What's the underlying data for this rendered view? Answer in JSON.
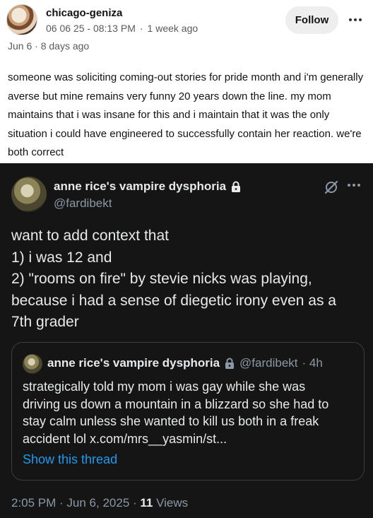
{
  "post": {
    "blog_name": "chicago-geniza",
    "reblog_timestamp": "06 06 25 - 08:13 PM",
    "relative_time": "1 week ago",
    "follow_label": "Follow",
    "post_date": "Jun 6 · 8 days ago",
    "body": "someone was soliciting coming-out stories for pride month and i'm generally averse but mine remains very funny 20 years down the line. my mom maintains that i was insane for this and i maintain that it was the only situation i could have engineered to successfully contain her reaction. we're both correct"
  },
  "tweet": {
    "display_name": "anne rice's vampire dysphoria",
    "handle": "@fardibekt",
    "text_lines": [
      "want to add context that",
      "1) i was 12 and",
      "2) \"rooms on fire\" by stevie nicks was playing,",
      "because i had a sense of diegetic irony even as a",
      "7th grader"
    ],
    "quote": {
      "display_name": "anne rice's vampire dysphoria",
      "handle": "@fardibekt",
      "time": "· 4h",
      "text_lines": [
        "strategically told my mom i was gay while she was",
        "driving us down a mountain in a blizzard so she had to",
        "stay calm unless she wanted to kill us both in a freak",
        "accident lol x.com/mrs__yasmin/st..."
      ],
      "show_thread": "Show this thread"
    },
    "footer_time": "2:05 PM · Jun 6, 2025 ·",
    "views_count": "11",
    "views_label": "Views"
  },
  "colors": {
    "tweet_bg": "#151515",
    "link_blue": "#1d9bf0",
    "muted_gray": "#8b98a5"
  },
  "icons": [
    "more-horizontal-icon",
    "lock-icon",
    "grok-icon"
  ]
}
